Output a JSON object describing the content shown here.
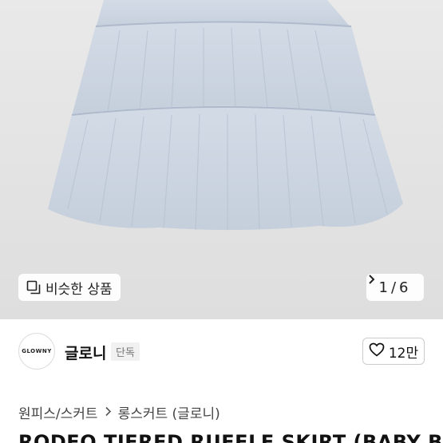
{
  "gallery": {
    "similar_label": "비슷한 상품",
    "current_page": "1",
    "separator": "/",
    "total_pages": "6"
  },
  "seller": {
    "avatar_text": "GLOWNY",
    "name": "글로니",
    "badge": "단독",
    "like_count": "12만"
  },
  "breadcrumb": {
    "category": "원피스/스커트",
    "subcategory": "롱스커트 (글로니)"
  },
  "product": {
    "title": "RODEO TIERED RUFFLE SKIRT (BABY B"
  },
  "colors": {
    "skirt": "#c9d3df",
    "background": "#e4e4e4"
  }
}
